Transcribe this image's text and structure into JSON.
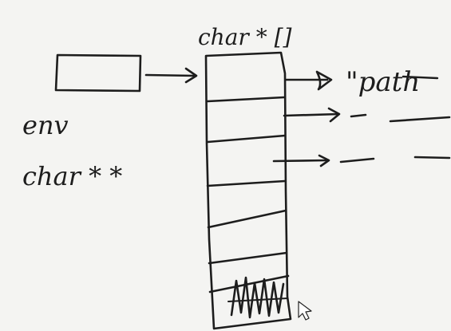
{
  "labels": {
    "array_type": "char * []",
    "env_name": "env",
    "env_type": "char * *",
    "first_string": "\"path",
    "terminator": "NULL"
  },
  "colors": {
    "ink": "#1d1d1d",
    "paper": "#f4f4f2"
  }
}
